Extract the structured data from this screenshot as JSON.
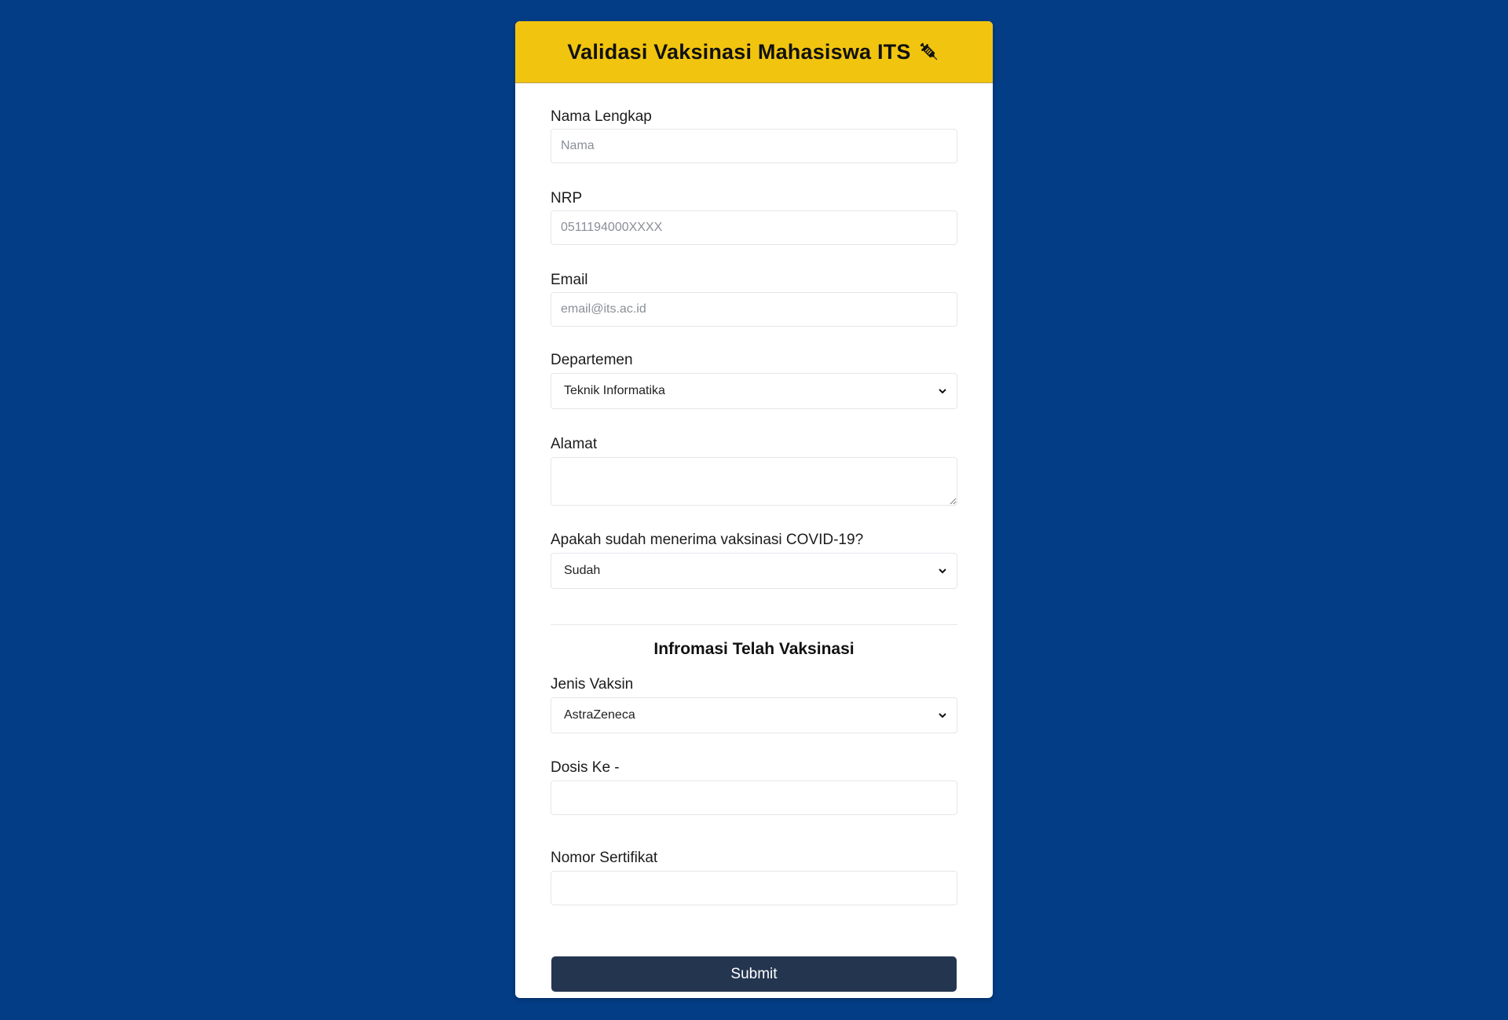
{
  "header": {
    "title": "Validasi Vaksinasi Mahasiswa ITS",
    "icon": "syringe-icon",
    "background": "#f1c40f"
  },
  "form": {
    "nama": {
      "label": "Nama Lengkap",
      "placeholder": "Nama",
      "value": ""
    },
    "nrp": {
      "label": "NRP",
      "placeholder": "0511194000XXXX",
      "value": ""
    },
    "email": {
      "label": "Email",
      "placeholder": "email@its.ac.id",
      "value": ""
    },
    "departemen": {
      "label": "Departemen",
      "selected": "Teknik Informatika"
    },
    "alamat": {
      "label": "Alamat",
      "value": ""
    },
    "vaksinasi": {
      "label": "Apakah sudah menerima vaksinasi COVID-19?",
      "selected": "Sudah"
    }
  },
  "vaccine_info": {
    "title": "Infromasi Telah Vaksinasi",
    "jenis": {
      "label": "Jenis Vaksin",
      "selected": "AstraZeneca"
    },
    "dosis": {
      "label": "Dosis Ke -",
      "value": ""
    },
    "sertifikat": {
      "label": "Nomor Sertifikat",
      "value": ""
    }
  },
  "submit_label": "Submit",
  "colors": {
    "page_background": "#033d86",
    "submit_background": "#243550"
  }
}
